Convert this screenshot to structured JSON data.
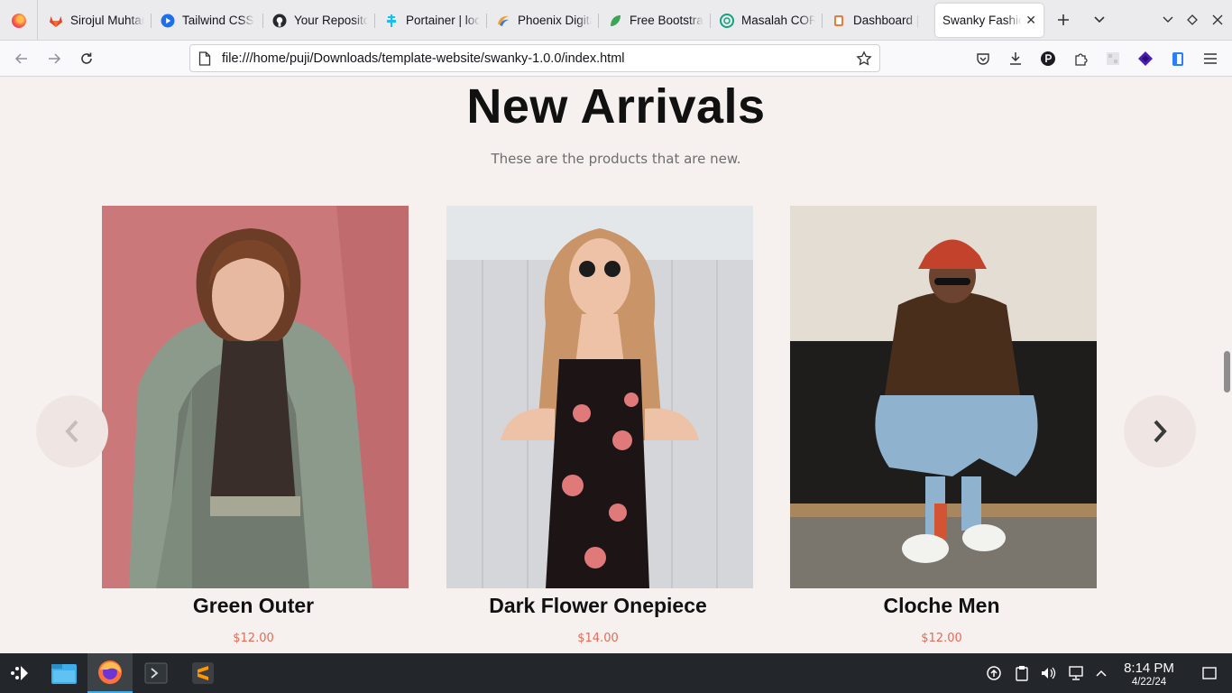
{
  "browser": {
    "tabs": [
      {
        "label": "Sirojul Muhtar",
        "icon": "gitlab-icon",
        "color": "#e24329"
      },
      {
        "label": "Tailwind CSS",
        "icon": "play-icon",
        "color": "#1f6feb"
      },
      {
        "label": "Your Repositories",
        "icon": "github-icon",
        "color": "#24292f"
      },
      {
        "label": "Portainer | local",
        "icon": "portainer-icon",
        "color": "#13bef9"
      },
      {
        "label": "Phoenix Digital",
        "icon": "phoenix-icon",
        "color": "#f0a030"
      },
      {
        "label": "Free Bootstrap",
        "icon": "leaf-icon",
        "color": "#3aa655"
      },
      {
        "label": "Masalah CORS",
        "icon": "chatgpt-icon",
        "color": "#10a37f"
      },
      {
        "label": "Dashboard | ",
        "icon": "dashboard-icon",
        "color": "#e87d3e"
      },
      {
        "label": "Swanky Fashion",
        "icon": "none",
        "color": "#ffffff",
        "active": true
      }
    ],
    "url": "file:///home/puji/Downloads/template-website/swanky-1.0.0/index.html"
  },
  "page": {
    "title": "New Arrivals",
    "subtitle": "These are the products that are new.",
    "products": [
      {
        "name": "Green Outer",
        "price": "$12.00"
      },
      {
        "name": "Dark Flower Onepiece",
        "price": "$14.00"
      },
      {
        "name": "Cloche Men",
        "price": "$12.00"
      }
    ],
    "accent_price_color": "#e26b57"
  },
  "taskbar": {
    "time": "8:14 PM",
    "date": "4/22/24"
  }
}
